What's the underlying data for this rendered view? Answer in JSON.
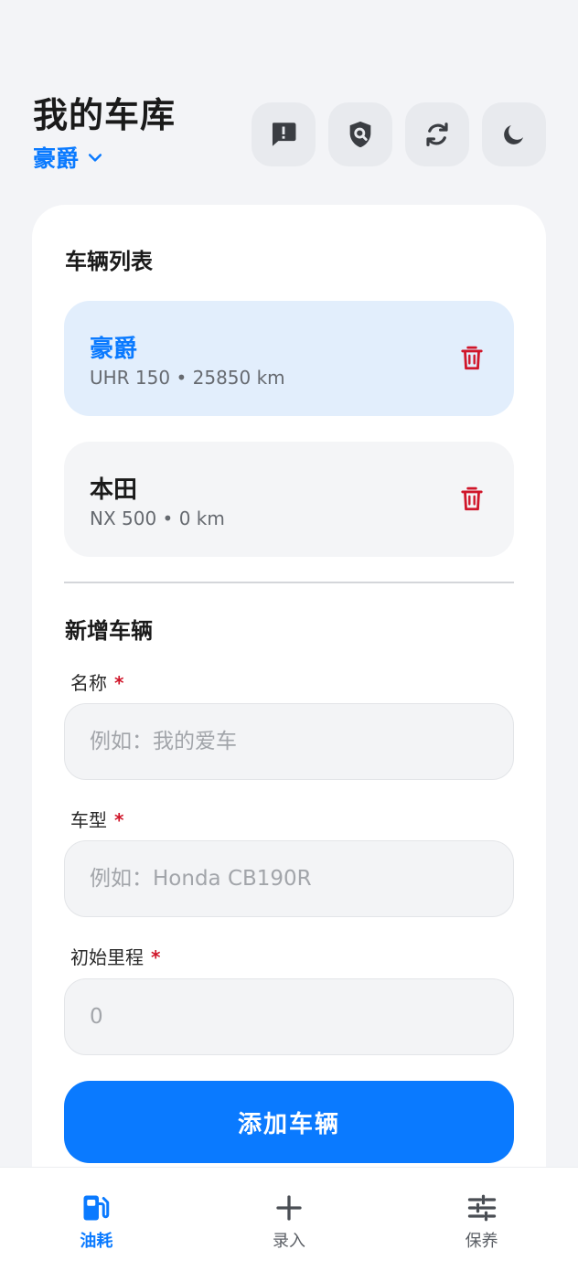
{
  "header": {
    "title": "我的车库",
    "current_vehicle": "豪爵"
  },
  "toolbar": {
    "icons": [
      "feedback-icon",
      "privacy-search-icon",
      "sync-icon",
      "dark-mode-icon"
    ]
  },
  "vehicle_list": {
    "title": "车辆列表",
    "items": [
      {
        "name": "豪爵",
        "meta": "UHR 150 • 25850 km",
        "active": true
      },
      {
        "name": "本田",
        "meta": "NX 500 • 0 km",
        "active": false
      }
    ]
  },
  "new_vehicle": {
    "title": "新增车辆",
    "required_mark": "*",
    "fields": [
      {
        "label": "名称",
        "placeholder": "例如：我的爱车",
        "value": ""
      },
      {
        "label": "车型",
        "placeholder": "例如：Honda CB190R",
        "value": ""
      },
      {
        "label": "初始里程",
        "placeholder": "0",
        "value": ""
      }
    ],
    "submit_label": "添加车辆"
  },
  "tabbar": {
    "tabs": [
      {
        "label": "油耗",
        "icon": "fuel-pump-icon",
        "active": true
      },
      {
        "label": "录入",
        "icon": "plus-icon",
        "active": false
      },
      {
        "label": "保养",
        "icon": "sliders-icon",
        "active": false
      }
    ]
  },
  "colors": {
    "accent": "#0a7aff",
    "danger": "#d0162a",
    "background": "#f3f4f7",
    "active_item": "#e2eefc"
  }
}
